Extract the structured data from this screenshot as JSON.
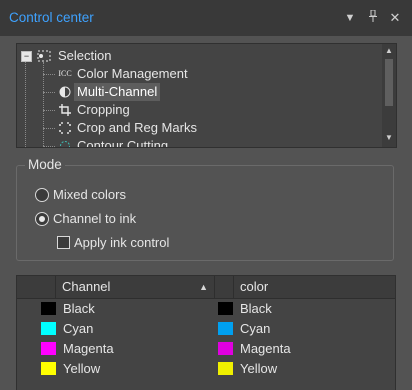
{
  "window": {
    "title": "Control center"
  },
  "titlebar": {
    "menu_icon": "chevron-down-icon",
    "pin_icon": "pin-icon",
    "close_icon": "close-icon"
  },
  "tree": {
    "root": {
      "label": "Selection",
      "icon": "selection-icon",
      "expanded": true
    },
    "items": [
      {
        "label": "Color Management",
        "icon": "icc-icon",
        "selected": false
      },
      {
        "label": "Multi-Channel",
        "icon": "half-circle-icon",
        "selected": true
      },
      {
        "label": "Cropping",
        "icon": "crop-icon",
        "selected": false
      },
      {
        "label": "Crop and Reg Marks",
        "icon": "crop-marks-icon",
        "selected": false
      },
      {
        "label": "Contour Cutting",
        "icon": "contour-cutting-icon",
        "selected": false
      }
    ]
  },
  "mode": {
    "title": "Mode",
    "options": [
      {
        "label": "Mixed colors",
        "checked": false
      },
      {
        "label": "Channel to ink",
        "checked": true
      }
    ],
    "apply_ink": {
      "label": "Apply ink control",
      "checked": false
    }
  },
  "table": {
    "columns": [
      {
        "label": "Channel",
        "sorted": "ascending"
      },
      {
        "label": "color"
      }
    ],
    "rows": [
      {
        "channel": "Black",
        "channel_color": "#000000",
        "ink": "Black",
        "ink_color": "#000000"
      },
      {
        "channel": "Cyan",
        "channel_color": "#00ffff",
        "ink": "Cyan",
        "ink_color": "#00a0f0"
      },
      {
        "channel": "Magenta",
        "channel_color": "#ff00ff",
        "ink": "Magenta",
        "ink_color": "#e000e0"
      },
      {
        "channel": "Yellow",
        "channel_color": "#ffff00",
        "ink": "Yellow",
        "ink_color": "#f0f000"
      }
    ]
  }
}
